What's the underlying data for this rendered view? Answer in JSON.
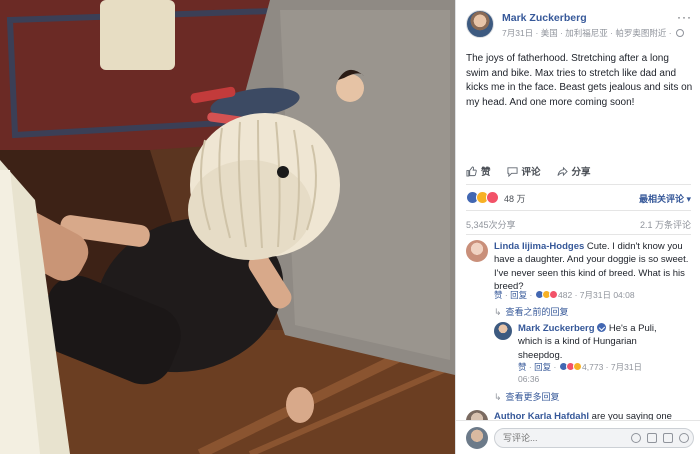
{
  "post": {
    "author": "Mark Zuckerberg",
    "meta": "7月31日 · 美国 · 加利福尼亚 · 帕罗奥图附近 ·",
    "text": "The joys of fatherhood. Stretching after a long swim and bike. Max tries to stretch like dad and kicks me in the face. Beast gets jealous and sits on my head. And one more coming soon!"
  },
  "actions": {
    "like": "赞",
    "comment": "评论",
    "share": "分享"
  },
  "reactions": {
    "count": "48 万",
    "sort_label": "最相关评论 ▾"
  },
  "stats": {
    "shares": "5,345次分享",
    "comments": "2.1 万条评论"
  },
  "comments": [
    {
      "name": "Linda Iijima-Hodges",
      "text": " Cute. I didn't know you have a daughter. And your doggie is so sweet. I've never seen this kind of breed. What is his breed?",
      "like": "赞",
      "reply": "回复",
      "react_count": "482",
      "time": "7月31日 04:08"
    }
  ],
  "view_prev_replies": "查看之前的回复",
  "reply": {
    "name": "Mark Zuckerberg",
    "text": " He's a Puli, which is a kind of Hungarian sheepdog.",
    "like": "赞",
    "reply": "回复",
    "react_count": "4,773",
    "time": "7月31日",
    "time2": "06:36"
  },
  "view_more_replies": "查看更多回复",
  "next_comment": {
    "name": "Author Karla Hafdahl",
    "text": " are you saying one"
  },
  "composer": {
    "placeholder": "写评论..."
  },
  "colors": {
    "link": "#365899",
    "muted": "#90949c",
    "like_blue": "#4267b2"
  }
}
